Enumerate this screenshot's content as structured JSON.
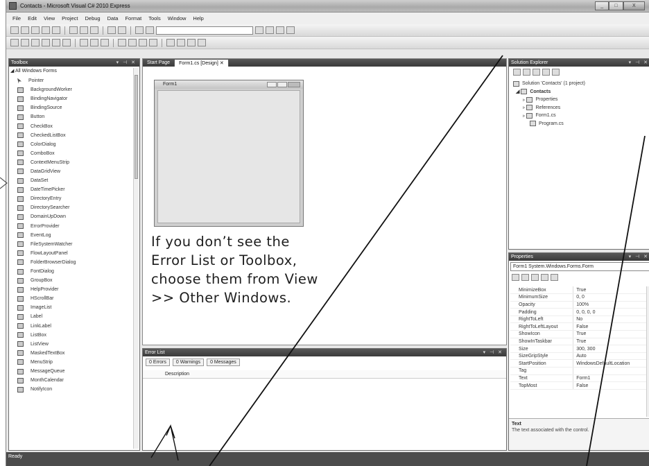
{
  "window": {
    "title": "Contacts - Microsoft Visual C# 2010 Express",
    "buttons": [
      "_",
      "□",
      "X"
    ]
  },
  "menu": [
    "File",
    "Edit",
    "View",
    "Project",
    "Debug",
    "Data",
    "Format",
    "Tools",
    "Window",
    "Help"
  ],
  "toolbox": {
    "title": "Toolbox",
    "group": "All Windows Forms",
    "items": [
      "Pointer",
      "BackgroundWorker",
      "BindingNavigator",
      "BindingSource",
      "Button",
      "CheckBox",
      "CheckedListBox",
      "ColorDialog",
      "ComboBox",
      "ContextMenuStrip",
      "DataGridView",
      "DataSet",
      "DateTimePicker",
      "DirectoryEntry",
      "DirectorySearcher",
      "DomainUpDown",
      "ErrorProvider",
      "EventLog",
      "FileSystemWatcher",
      "FlowLayoutPanel",
      "FolderBrowserDialog",
      "FontDialog",
      "GroupBox",
      "HelpProvider",
      "HScrollBar",
      "ImageList",
      "Label",
      "LinkLabel",
      "ListBox",
      "ListView",
      "MaskedTextBox",
      "MenuStrip",
      "MessageQueue",
      "MonthCalendar",
      "NotifyIcon"
    ]
  },
  "editor": {
    "tabs": [
      "Start Page",
      "Form1.cs [Design]"
    ],
    "form_title": "Form1"
  },
  "annotation": {
    "lines": [
      "If you don’t see the",
      "Error List or Toolbox,",
      "choose them from View",
      ">> Other Windows."
    ]
  },
  "error_list": {
    "title": "Error List",
    "filters": [
      "0 Errors",
      "0 Warnings",
      "0 Messages"
    ],
    "column": "Description"
  },
  "solution_explorer": {
    "title": "Solution Explorer",
    "items": [
      "Solution 'Contacts' (1 project)",
      "Contacts",
      "Properties",
      "References",
      "Form1.cs",
      "Program.cs"
    ]
  },
  "properties": {
    "title": "Properties",
    "object": "Form1  System.Windows.Forms.Form",
    "rows": [
      [
        "MinimizeBox",
        "True"
      ],
      [
        "MinimumSize",
        "0, 0"
      ],
      [
        "Opacity",
        "100%"
      ],
      [
        "Padding",
        "0, 0, 0, 0"
      ],
      [
        "RightToLeft",
        "No"
      ],
      [
        "RightToLeftLayout",
        "False"
      ],
      [
        "ShowIcon",
        "True"
      ],
      [
        "ShowInTaskbar",
        "True"
      ],
      [
        "Size",
        "300, 300"
      ],
      [
        "SizeGripStyle",
        "Auto"
      ],
      [
        "StartPosition",
        "WindowsDefaultLocation"
      ],
      [
        "Tag",
        ""
      ],
      [
        "Text",
        "Form1"
      ],
      [
        "TopMost",
        "False"
      ]
    ],
    "desc_title": "Text",
    "desc_text": "The text associated with the control."
  },
  "status": "Ready"
}
